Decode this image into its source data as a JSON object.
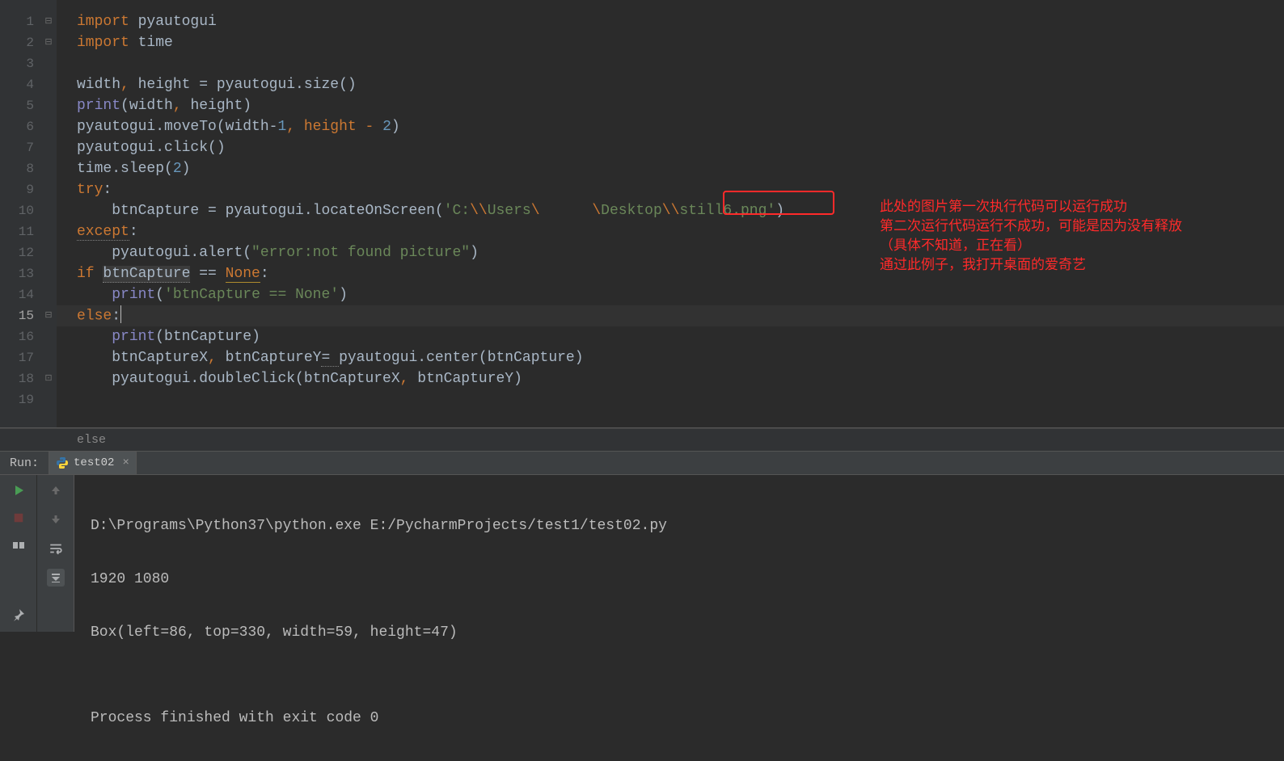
{
  "editor": {
    "line_numbers": [
      "1",
      "2",
      "3",
      "4",
      "5",
      "6",
      "7",
      "8",
      "9",
      "10",
      "11",
      "12",
      "13",
      "14",
      "15",
      "16",
      "17",
      "18",
      "19"
    ],
    "current_line_index": 14,
    "fold_markers": {
      "0": "open",
      "1": "open",
      "14": "open",
      "17": "close"
    },
    "code": {
      "l1": {
        "kw": "import ",
        "mod": "pyautogui"
      },
      "l2": {
        "kw": "import ",
        "mod": "time"
      },
      "l4": {
        "lhs": "width",
        "c1": ", ",
        "rhs": "height = pyautogui.size()"
      },
      "l5": {
        "fn": "print",
        "args_open": "(",
        "a1": "width",
        "c": ", ",
        "a2": "height",
        "close": ")"
      },
      "l6": {
        "pre": "pyautogui.moveTo(width-",
        "n1": "1",
        "mid": ", height - ",
        "n2": "2",
        "end": ")"
      },
      "l7": {
        "txt": "pyautogui.click()"
      },
      "l8": {
        "pre": "time.sleep(",
        "n": "2",
        "end": ")"
      },
      "l9": {
        "kw": "try",
        "colon": ":"
      },
      "l10": {
        "pre": "    btnCapture = pyautogui.locateOnScreen(",
        "str_a": "'C:",
        "esc1": "\\\\",
        "str_b": "Users",
        "esc2": "\\",
        "blur": "      ",
        "esc3": "\\",
        "str_c": "Desktop",
        "esc4": "\\\\",
        "str_d": "still6.png'",
        "end": ")"
      },
      "l11": {
        "kw": "except",
        "colon": ":"
      },
      "l12": {
        "pre": "    pyautogui.alert(",
        "str": "\"error:not found picture\"",
        "end": ")"
      },
      "l13": {
        "kw": "if ",
        "var": "btnCapture",
        "eq": " == ",
        "none": "None",
        "colon": ":"
      },
      "l14": {
        "pre": "    ",
        "fn": "print",
        "open": "(",
        "str": "'btnCapture == None'",
        "close": ")"
      },
      "l15": {
        "kw": "else",
        "colon": ":"
      },
      "l16": {
        "pre": "    ",
        "fn": "print",
        "open": "(",
        "arg": "btnCapture)",
        "close": ""
      },
      "l17": {
        "txt": "    btnCaptureX",
        "c1": ", ",
        "txt2": "btnCaptureY",
        "eq": "= ",
        "rest": "pyautogui.center(btnCapture)"
      },
      "l18": {
        "txt": "    pyautogui.doubleClick(btnCaptureX",
        "c": ", ",
        "txt2": "btnCaptureY)"
      }
    }
  },
  "callout_text": {
    "l1": "此处的图片第一次执行代码可以运行成功",
    "l2": "第二次运行代码运行不成功，可能是因为没有释放",
    "l3": "（具体不知道，正在看）",
    "l4": "通过此例子，我打开桌面的爱奇艺"
  },
  "highlight_filename": "still6.png",
  "breadcrumb": "else",
  "run": {
    "label": "Run:",
    "tab_name": "test02",
    "console_lines": [
      "D:\\Programs\\Python37\\python.exe E:/PycharmProjects/test1/test02.py",
      "1920 1080",
      "Box(left=86, top=330, width=59, height=47)",
      "",
      "Process finished with exit code 0"
    ]
  }
}
